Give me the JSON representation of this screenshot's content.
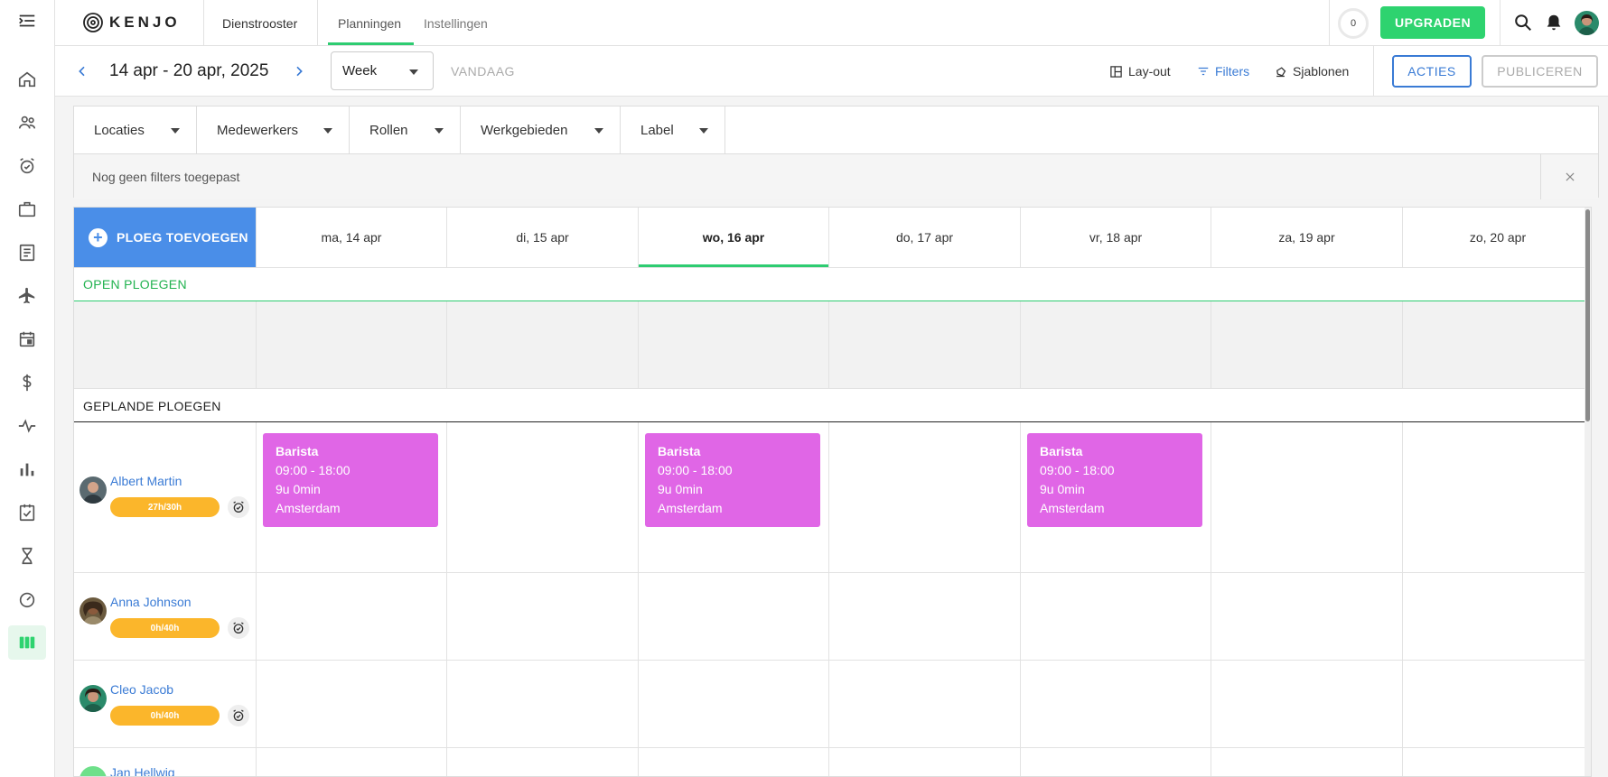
{
  "app": {
    "logo_text": "KENJO",
    "nav_link": "Dienstrooster",
    "tabs": [
      {
        "label": "Planningen",
        "active": true
      },
      {
        "label": "Instellingen",
        "active": false
      }
    ],
    "notification_count": "0",
    "upgrade_label": "UPGRADEN",
    "accent_color": "#2ed36f"
  },
  "toolbar": {
    "date_range": "14 apr - 20 apr, 2025",
    "view_select": "Week",
    "today_label": "VANDAAG",
    "layout_label": "Lay-out",
    "filters_label": "Filters",
    "templates_label": "Sjablonen",
    "actions_label": "ACTIES",
    "publish_label": "PUBLICEREN"
  },
  "filters": {
    "dropdowns": [
      "Locaties",
      "Medewerkers",
      "Rollen",
      "Werkgebieden",
      "Label"
    ],
    "empty_text": "Nog geen filters toegepast"
  },
  "schedule": {
    "add_shift_label": "PLOEG TOEVOEGEN",
    "days": [
      {
        "label": "ma, 14 apr",
        "today": false
      },
      {
        "label": "di, 15 apr",
        "today": false
      },
      {
        "label": "wo, 16 apr",
        "today": true
      },
      {
        "label": "do, 17 apr",
        "today": false
      },
      {
        "label": "vr, 18 apr",
        "today": false
      },
      {
        "label": "za, 19 apr",
        "today": false
      },
      {
        "label": "zo, 20 apr",
        "today": false
      }
    ],
    "open_section": "OPEN PLOEGEN",
    "planned_section": "GEPLANDE PLOEGEN",
    "employees": [
      {
        "name": "Albert Martin",
        "hours": "27h/30h"
      },
      {
        "name": "Anna Johnson",
        "hours": "0h/40h"
      },
      {
        "name": "Cleo Jacob",
        "hours": "0h/40h"
      },
      {
        "name": "Jan Hellwig",
        "hours": ""
      }
    ],
    "shifts": [
      {
        "role": "Barista",
        "time": "09:00 - 18:00",
        "duration": "9u 0min",
        "location": "Amsterdam",
        "day": 0,
        "employee": 0
      },
      {
        "role": "Barista",
        "time": "09:00 - 18:00",
        "duration": "9u 0min",
        "location": "Amsterdam",
        "day": 2,
        "employee": 0
      },
      {
        "role": "Barista",
        "time": "09:00 - 18:00",
        "duration": "9u 0min",
        "location": "Amsterdam",
        "day": 4,
        "employee": 0
      }
    ],
    "shift_color": "#e066e6",
    "hours_badge_color": "#fbb62b"
  }
}
